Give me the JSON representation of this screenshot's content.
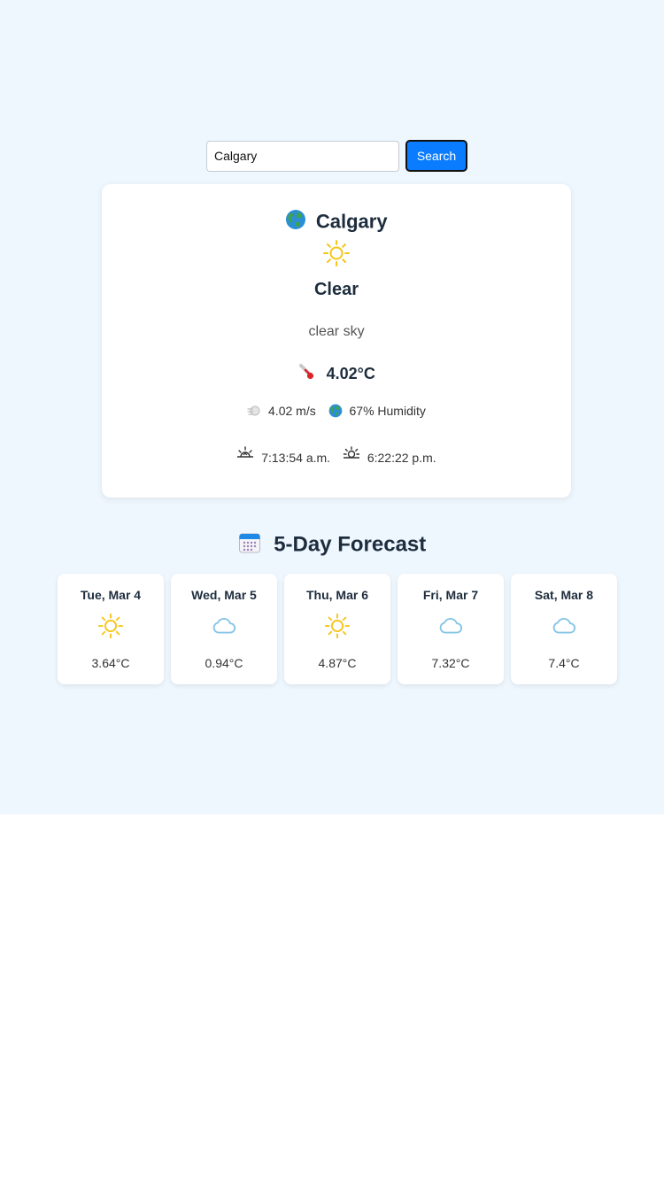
{
  "search": {
    "value": "Calgary",
    "button_label": "Search"
  },
  "current": {
    "city": "Calgary",
    "condition": "Clear",
    "description": "clear sky",
    "temperature": "4.02°C",
    "wind": "4.02 m/s",
    "humidity": "67% Humidity",
    "sunrise": "7:13:54 a.m.",
    "sunset": "6:22:22 p.m.",
    "icon": "sun-icon"
  },
  "forecast": {
    "title": "5-Day Forecast",
    "days": [
      {
        "day": "Tue, Mar 4",
        "temp": "3.64°C",
        "icon": "sun-icon"
      },
      {
        "day": "Wed, Mar 5",
        "temp": "0.94°C",
        "icon": "cloud-icon"
      },
      {
        "day": "Thu, Mar 6",
        "temp": "4.87°C",
        "icon": "sun-icon"
      },
      {
        "day": "Fri, Mar 7",
        "temp": "7.32°C",
        "icon": "cloud-icon"
      },
      {
        "day": "Sat, Mar 8",
        "temp": "7.4°C",
        "icon": "cloud-icon"
      }
    ]
  },
  "colors": {
    "page_bg": "#eef6fe",
    "accent": "#0a7cff",
    "sun": "#f5c518",
    "cloud": "#86c5e6"
  }
}
